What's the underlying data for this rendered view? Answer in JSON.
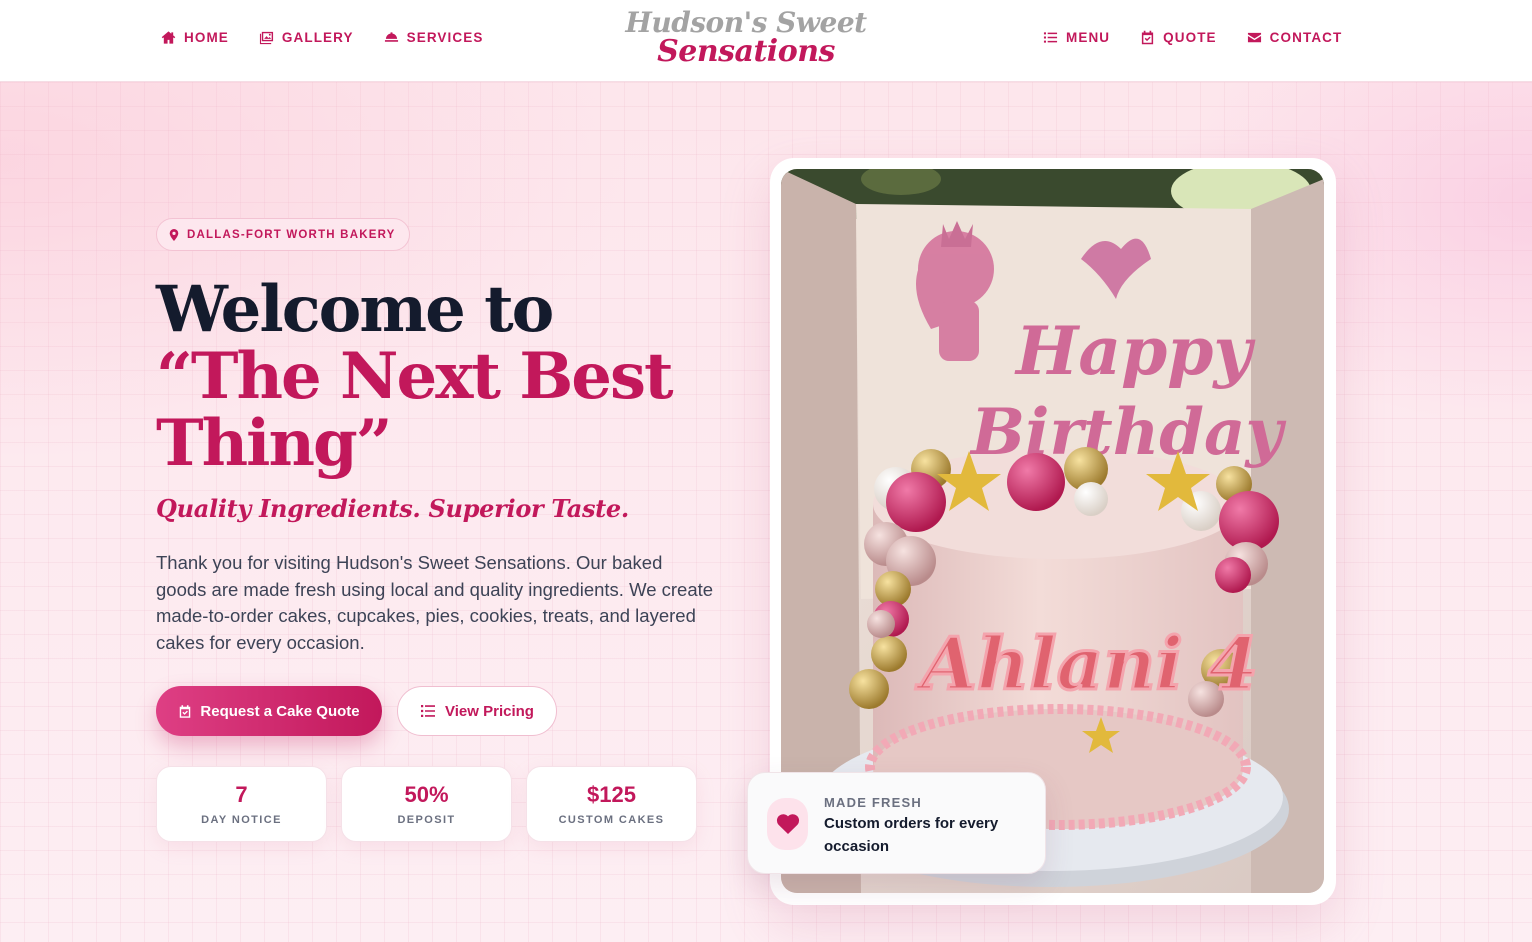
{
  "brand": {
    "line1": "Hudson's Sweet",
    "line2": "Sensations",
    "colors": {
      "accent": "#c2185b",
      "dark": "#141b2d",
      "muted_logo": "#a3a3a3",
      "background": "#fdeef2"
    }
  },
  "nav": {
    "left": [
      {
        "label": "HOME",
        "icon": "home-icon"
      },
      {
        "label": "GALLERY",
        "icon": "gallery-icon"
      },
      {
        "label": "SERVICES",
        "icon": "cloche-icon"
      }
    ],
    "right": [
      {
        "label": "MENU",
        "icon": "list-icon"
      },
      {
        "label": "QUOTE",
        "icon": "calendar-check-icon"
      },
      {
        "label": "CONTACT",
        "icon": "envelope-icon"
      }
    ]
  },
  "hero": {
    "badge": {
      "text": "DALLAS-FORT WORTH BAKERY",
      "icon": "map-pin-icon"
    },
    "headline_line1": "Welcome to",
    "headline_line2": "“The Next Best",
    "headline_line3": "Thing”",
    "tagline": "Quality Ingredients. Superior Taste.",
    "intro": "Thank you for visiting Hudson's Sweet Sensations. Our baked goods are made fresh using local and quality ingredients. We create made-to-order cakes, cupcakes, pies, cookies, treats, and layered cakes for every occasion.",
    "primary_button": {
      "label": "Request a Cake Quote",
      "icon": "calendar-check-icon"
    },
    "secondary_button": {
      "label": "View Pricing",
      "icon": "list-icon"
    },
    "stats": [
      {
        "value": "7",
        "label": "DAY NOTICE"
      },
      {
        "value": "50%",
        "label": "DEPOSIT"
      },
      {
        "value": "$125",
        "label": "CUSTOM CAKES"
      }
    ]
  },
  "photo": {
    "topper_line1": "Happy",
    "topper_line2": "Birthday",
    "cake_name": "Ahlani 4"
  },
  "fresh_card": {
    "icon": "heart-icon",
    "kicker": "MADE FRESH",
    "text": "Custom orders for every occasion"
  }
}
